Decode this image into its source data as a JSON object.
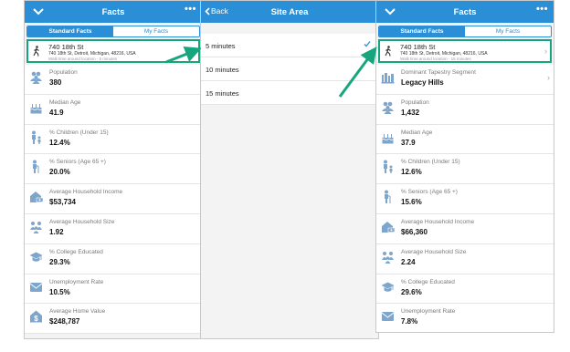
{
  "colors": {
    "header": "#2a8fd6",
    "highlight": "#17a57e",
    "icon": "#7ea6cc"
  },
  "screen1": {
    "title": "Facts",
    "menu": "•••",
    "tabs": [
      "Standard Facts",
      "My Facts"
    ],
    "location": {
      "name": "740 18th St",
      "address": "740 18th St, Detroit, Michigan, 48216, USA",
      "note": "Walk time around location - 5 minutes"
    },
    "facts": [
      {
        "icon": "people-icon",
        "label": "Population",
        "value": "380"
      },
      {
        "icon": "birthday-cake-icon",
        "label": "Median Age",
        "value": "41.9"
      },
      {
        "icon": "parent-child-icon",
        "label": "% Children (Under 15)",
        "value": "12.4%"
      },
      {
        "icon": "senior-icon",
        "label": "% Seniors (Age 65 +)",
        "value": "20.0%"
      },
      {
        "icon": "house-money-icon",
        "label": "Average Household Income",
        "value": "$53,734"
      },
      {
        "icon": "household-icon",
        "label": "Average Household Size",
        "value": "1.92"
      },
      {
        "icon": "graduation-cap-icon",
        "label": "% College Educated",
        "value": "29.3%"
      },
      {
        "icon": "unemployment-icon",
        "label": "Unemployment Rate",
        "value": "10.5%"
      },
      {
        "icon": "home-value-icon",
        "label": "Average Home Value",
        "value": "$248,787"
      }
    ]
  },
  "screen2": {
    "title": "Site Area",
    "back": "Back",
    "options": [
      {
        "label": "5 minutes",
        "selected": true
      },
      {
        "label": "10 minutes",
        "selected": false
      },
      {
        "label": "15 minutes",
        "selected": false
      }
    ]
  },
  "screen3": {
    "title": "Facts",
    "menu": "•••",
    "tabs": [
      "Standard Facts",
      "My Facts"
    ],
    "location": {
      "name": "740 18th St",
      "address": "740 18th St, Detroit, Michigan, 48216, USA",
      "note": "Walk time around location - 15 minutes"
    },
    "facts": [
      {
        "icon": "tapestry-icon",
        "label": "Dominant Tapestry Segment",
        "value": "Legacy Hills",
        "chevron": true
      },
      {
        "icon": "people-icon",
        "label": "Population",
        "value": "1,432"
      },
      {
        "icon": "birthday-cake-icon",
        "label": "Median Age",
        "value": "37.9"
      },
      {
        "icon": "parent-child-icon",
        "label": "% Children (Under 15)",
        "value": "12.6%"
      },
      {
        "icon": "senior-icon",
        "label": "% Seniors (Age 65 +)",
        "value": "15.6%"
      },
      {
        "icon": "house-money-icon",
        "label": "Average Household Income",
        "value": "$66,360"
      },
      {
        "icon": "household-icon",
        "label": "Average Household Size",
        "value": "2.24"
      },
      {
        "icon": "graduation-cap-icon",
        "label": "% College Educated",
        "value": "29.6%"
      },
      {
        "icon": "unemployment-icon",
        "label": "Unemployment Rate",
        "value": "7.8%"
      }
    ]
  }
}
